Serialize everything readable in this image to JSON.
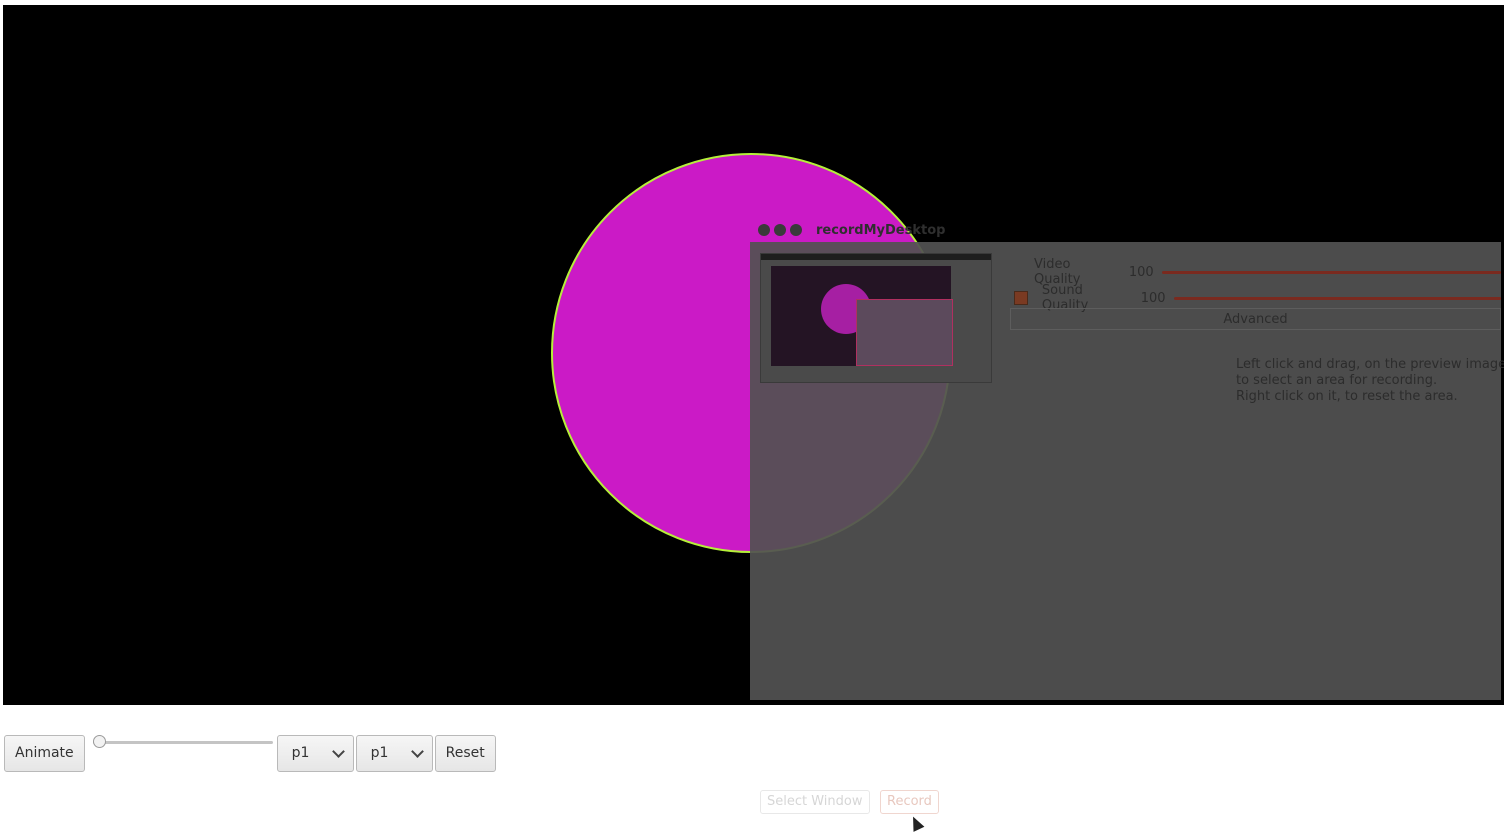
{
  "recorder": {
    "title": "recordMyDesktop",
    "video_quality_label": "Video Quality",
    "video_quality_value": "100",
    "sound_quality_label": "Sound Quality",
    "sound_quality_value": "100",
    "advanced_label": "Advanced",
    "info_line1": "Left click and drag, on the preview image",
    "info_line2": "to select an area for recording.",
    "info_line3": "Right click on it, to reset the area.",
    "select_window_label": "Select Window",
    "record_label": "Record"
  },
  "controls": {
    "animate_label": "Animate",
    "slider_value": 0,
    "select1_value": "p1",
    "select2_value": "p1",
    "reset_label": "Reset"
  },
  "colors": {
    "circle_fill": "#ec1ee6",
    "circle_stroke": "#b6f03a",
    "stage_bg": "#000000"
  }
}
